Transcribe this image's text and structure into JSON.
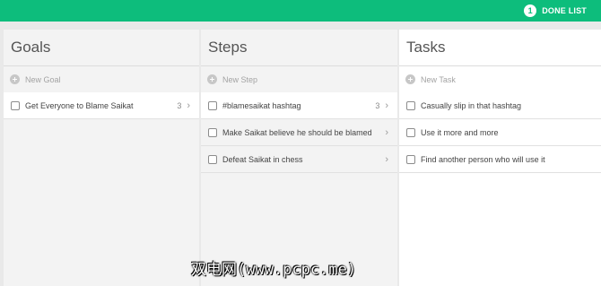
{
  "colors": {
    "accent": "#0dbd7c"
  },
  "topbar": {
    "done_count": "1",
    "done_label": "DONE LIST"
  },
  "columns": {
    "goals": {
      "title": "Goals",
      "new_label": "New Goal",
      "items": [
        {
          "label": "Get Everyone to Blame Saikat",
          "count": "3",
          "selected": true
        }
      ]
    },
    "steps": {
      "title": "Steps",
      "new_label": "New Step",
      "items": [
        {
          "label": "#blamesaikat hashtag",
          "count": "3",
          "selected": true
        },
        {
          "label": "Make Saikat believe he should be blamed"
        },
        {
          "label": "Defeat Saikat in chess"
        }
      ]
    },
    "tasks": {
      "title": "Tasks",
      "new_label": "New Task",
      "items": [
        {
          "label": "Casually slip in that hashtag"
        },
        {
          "label": "Use it more and more"
        },
        {
          "label": "Find another person who will use it"
        }
      ]
    }
  },
  "watermark": "双电网(www.pcpc.me)"
}
